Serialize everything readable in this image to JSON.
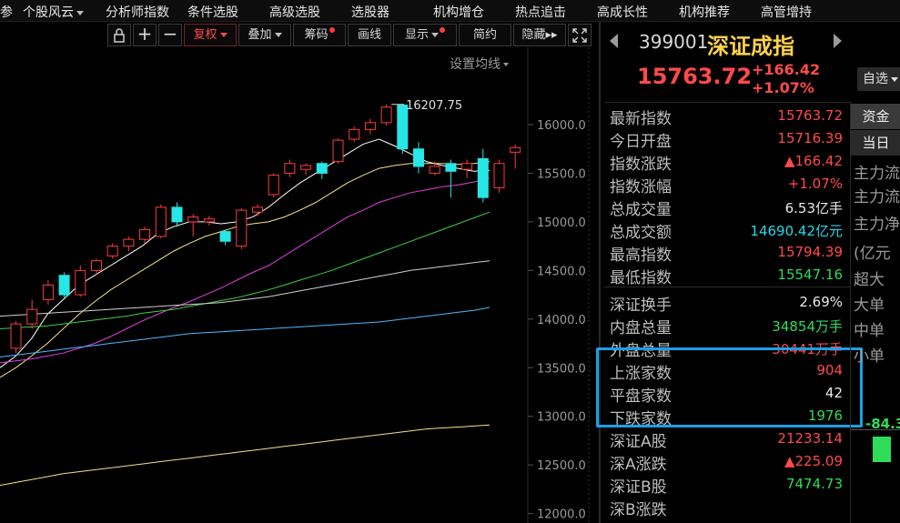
{
  "menu": {
    "items": [
      "参",
      "个股风云",
      "分析师指数",
      "条件选股",
      "高级选股",
      "选股器",
      "机构增仓",
      "热点追击",
      "高成长性",
      "机构推荐",
      "高管增持"
    ]
  },
  "toolbar": {
    "fuquan": "复权",
    "overlay": "叠加",
    "chips": "筹码",
    "draw": "画线",
    "display": "显示",
    "simple": "简约",
    "hide": "隐藏"
  },
  "chart": {
    "ma_setting": "设置均线",
    "peak_label": "16207.75",
    "y_ticks": [
      "16000.0",
      "15500.0",
      "15000.0",
      "14500.0",
      "14000.0",
      "13500.0",
      "13000.0",
      "12500.0",
      "12000.0"
    ],
    "colors": {
      "up": "#ff3b3b",
      "down": "#27e6e6",
      "ma5": "#ffffff",
      "ma10": "#f2e28a",
      "ma20": "#e040e0",
      "ma30": "#40d040",
      "ma60": "#d0d0d0",
      "ma120": "#4fb8ff",
      "ma250": "#f2e28a"
    }
  },
  "chart_data": {
    "type": "candlestick",
    "ylim": [
      12000,
      16500
    ],
    "peak": 16207.75,
    "candles": [
      [
        13700,
        13950,
        13650,
        13980
      ],
      [
        13950,
        14100,
        13900,
        14200
      ],
      [
        14200,
        14350,
        14150,
        14400
      ],
      [
        14450,
        14250,
        14200,
        14480
      ],
      [
        14250,
        14500,
        14230,
        14550
      ],
      [
        14500,
        14600,
        14450,
        14620
      ],
      [
        14650,
        14750,
        14620,
        14780
      ],
      [
        14750,
        14820,
        14700,
        14850
      ],
      [
        14820,
        14920,
        14780,
        14950
      ],
      [
        14850,
        15150,
        14830,
        15180
      ],
      [
        15150,
        15000,
        14950,
        15200
      ],
      [
        15000,
        15050,
        14850,
        15080
      ],
      [
        15000,
        15030,
        14960,
        15060
      ],
      [
        14900,
        14800,
        14760,
        14920
      ],
      [
        14750,
        15120,
        14720,
        15140
      ],
      [
        15100,
        15150,
        15060,
        15180
      ],
      [
        15280,
        15480,
        15250,
        15500
      ],
      [
        15500,
        15600,
        15460,
        15640
      ],
      [
        15540,
        15580,
        15480,
        15600
      ],
      [
        15600,
        15500,
        15440,
        15620
      ],
      [
        15620,
        15840,
        15600,
        15860
      ],
      [
        15850,
        15950,
        15820,
        15980
      ],
      [
        15950,
        16020,
        15900,
        16060
      ],
      [
        16020,
        16180,
        15990,
        16207.75
      ],
      [
        16200,
        15750,
        15700,
        16210
      ],
      [
        15750,
        15570,
        15500,
        15820
      ],
      [
        15500,
        15570,
        15480,
        15620
      ],
      [
        15600,
        15520,
        15250,
        15640
      ],
      [
        15540,
        15600,
        15450,
        15640
      ],
      [
        15650,
        15250,
        15200,
        15750
      ],
      [
        15350,
        15600,
        15300,
        15640
      ],
      [
        15716.39,
        15763.72,
        15547.16,
        15794.39
      ]
    ],
    "moving_averages": {
      "ma5": [
        13500,
        13620,
        13800,
        14050,
        14200,
        14350,
        14450,
        14550,
        14650,
        14750,
        14880,
        14950,
        15000,
        15000,
        14980,
        15000,
        15050,
        15150,
        15280,
        15400,
        15500,
        15600,
        15700,
        15800,
        15850,
        15780,
        15700,
        15620,
        15580,
        15550,
        15520,
        15530
      ],
      "ma10": [
        13400,
        13500,
        13620,
        13750,
        13900,
        14050,
        14180,
        14300,
        14400,
        14500,
        14600,
        14700,
        14780,
        14850,
        14900,
        14950,
        14980,
        15000,
        15050,
        15120,
        15200,
        15300,
        15400,
        15480,
        15550,
        15580,
        15600,
        15600,
        15600,
        15590,
        15600,
        15620
      ],
      "ma20": [
        13550,
        13570,
        13590,
        13620,
        13650,
        13700,
        13750,
        13820,
        13900,
        13980,
        14050,
        14120,
        14180,
        14250,
        14320,
        14400,
        14480,
        14550,
        14650,
        14750,
        14850,
        14950,
        15050,
        15120,
        15200,
        15250,
        15300,
        15330,
        15360,
        15380,
        15410,
        15450
      ],
      "ma30": [
        13900,
        13910,
        13920,
        13930,
        13950,
        13970,
        13990,
        14010,
        14030,
        14060,
        14080,
        14100,
        14130,
        14160,
        14190,
        14220,
        14260,
        14300,
        14350,
        14400,
        14450,
        14500,
        14560,
        14620,
        14680,
        14740,
        14800,
        14860,
        14920,
        14980,
        15040,
        15100
      ],
      "ma60": [
        14030,
        14040,
        14050,
        14060,
        14070,
        14080,
        14090,
        14100,
        14110,
        14120,
        14130,
        14140,
        14150,
        14160,
        14170,
        14190,
        14210,
        14230,
        14260,
        14290,
        14320,
        14350,
        14380,
        14410,
        14440,
        14470,
        14500,
        14520,
        14540,
        14560,
        14580,
        14600
      ],
      "ma120": [
        13610,
        13630,
        13650,
        13670,
        13690,
        13710,
        13730,
        13750,
        13770,
        13790,
        13810,
        13830,
        13850,
        13860,
        13870,
        13880,
        13890,
        13900,
        13910,
        13920,
        13930,
        13940,
        13950,
        13960,
        13970,
        13990,
        14010,
        14030,
        14050,
        14070,
        14090,
        14120
      ],
      "ma250": [
        12290,
        12320,
        12350,
        12380,
        12410,
        12430,
        12450,
        12470,
        12490,
        12510,
        12530,
        12550,
        12570,
        12590,
        12610,
        12630,
        12650,
        12670,
        12690,
        12710,
        12730,
        12750,
        12770,
        12790,
        12810,
        12830,
        12850,
        12870,
        12880,
        12890,
        12900,
        12910
      ]
    }
  },
  "quote": {
    "code": "399001",
    "name": "深证成指",
    "price": "15763.72",
    "change": "+166.42",
    "change_pct": "+1.07%",
    "watch_label": "自选"
  },
  "stats": [
    {
      "label": "最新指数",
      "value": "15763.72",
      "color": "#ff4a4a"
    },
    {
      "label": "今日开盘",
      "value": "15716.39",
      "color": "#ff4a4a"
    },
    {
      "label": "指数涨跌",
      "value": "▲166.42",
      "color": "#ff4a4a"
    },
    {
      "label": "指数涨幅",
      "value": "+1.07%",
      "color": "#ff4a4a"
    },
    {
      "label": "总成交量",
      "value": "6.53亿手",
      "color": "#e8e8e8"
    },
    {
      "label": "总成交额",
      "value": "14690.42亿元",
      "color": "#27d8e8"
    },
    {
      "label": "最高指数",
      "value": "15794.39",
      "color": "#ff4a4a"
    },
    {
      "label": "最低指数",
      "value": "15547.16",
      "color": "#2fdc5a"
    },
    {
      "label": "深证换手",
      "value": "2.69%",
      "color": "#e8e8e8"
    },
    {
      "label": "内盘总量",
      "value": "34854万手",
      "color": "#2fdc5a"
    },
    {
      "label": "外盘总量",
      "value": "30441万手",
      "color": "#ff4a4a"
    },
    {
      "label": "上涨家数",
      "value": "904",
      "color": "#ff4a4a"
    },
    {
      "label": "平盘家数",
      "value": "42",
      "color": "#e8e8e8"
    },
    {
      "label": "下跌家数",
      "value": "1976",
      "color": "#2fdc5a"
    },
    {
      "label": "深证A股",
      "value": "21233.14",
      "color": "#ff4a4a"
    },
    {
      "label": "深A涨跌",
      "value": "▲225.09",
      "color": "#ff4a4a"
    },
    {
      "label": "深证B股",
      "value": "7474.73",
      "color": "#2fdc5a"
    },
    {
      "label": "深B涨跌",
      "value": "",
      "color": "#2fdc5a"
    }
  ],
  "fund": {
    "tab_fund": "资金",
    "tab_today": "当日",
    "labels": [
      "主力流",
      "主力流",
      "主力净",
      "(亿元",
      "超大",
      "大单",
      "中单",
      "小单"
    ],
    "value": "-84.3"
  }
}
